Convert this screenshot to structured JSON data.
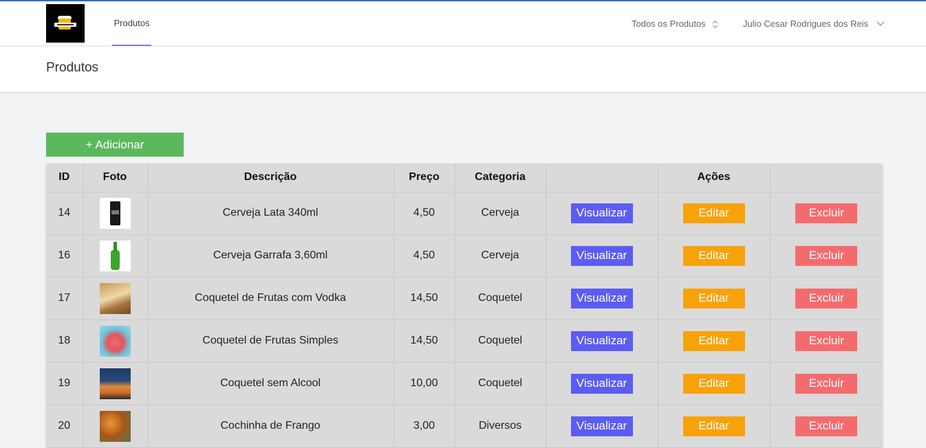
{
  "navbar": {
    "tab_label": "Produtos",
    "filter_label": "Todos os Produtos",
    "user_name": "Julio Cesar Rodrigues dos Reis"
  },
  "page": {
    "title": "Produtos",
    "add_button_label": "+ Adicionar"
  },
  "table": {
    "headers": {
      "id": "ID",
      "foto": "Foto",
      "descricao": "Descrição",
      "preco": "Preço",
      "categoria": "Categoria",
      "acoes": "Ações"
    },
    "actions": {
      "view": "Visualizar",
      "edit": "Editar",
      "delete": "Excluir"
    },
    "rows": [
      {
        "id": "14",
        "descricao": "Cerveja Lata 340ml",
        "preco": "4,50",
        "categoria": "Cerveja",
        "photo": "beer-can"
      },
      {
        "id": "16",
        "descricao": "Cerveja Garrafa 3,60ml",
        "preco": "4,50",
        "categoria": "Cerveja",
        "photo": "beer-bottle"
      },
      {
        "id": "17",
        "descricao": "Coquetel de Frutas com Vodka",
        "preco": "14,50",
        "categoria": "Coquetel",
        "photo": "fruit-cocktail"
      },
      {
        "id": "18",
        "descricao": "Coquetel de Frutas Simples",
        "preco": "14,50",
        "categoria": "Coquetel",
        "photo": "pink-cocktail"
      },
      {
        "id": "19",
        "descricao": "Coquetel sem Alcool",
        "preco": "10,00",
        "categoria": "Coquetel",
        "photo": "orange-cocktail"
      },
      {
        "id": "20",
        "descricao": "Cochinha de Frango",
        "preco": "3,00",
        "categoria": "Diversos",
        "photo": "coxinha"
      }
    ]
  },
  "colors": {
    "view_button": "#5c5cf2",
    "edit_button": "#f7a20a",
    "delete_button": "#f46b6e",
    "add_button": "#5cb85c",
    "tab_underline": "#7a7fd6"
  }
}
